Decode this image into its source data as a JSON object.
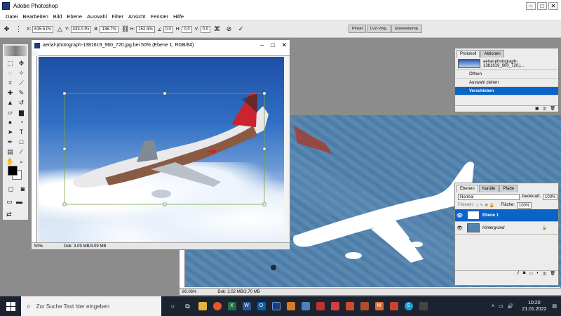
{
  "app": {
    "title": "Adobe Photoshop"
  },
  "window_controls": {
    "minimize": "–",
    "maximize": "□",
    "close": "✕"
  },
  "menu": [
    "Datei",
    "Bearbeiten",
    "Bild",
    "Ebene",
    "Auswahl",
    "Filter",
    "Ansicht",
    "Fenster",
    "Hilfe"
  ],
  "options": {
    "x_label": "X:",
    "x_value": "615.5 Px",
    "y_label": "Y:",
    "y_value": "433.0 Px",
    "b_label": "B:",
    "b_value": "136.7%",
    "h_label": "H:",
    "h_value": "152.4%",
    "angle_value": "0.0",
    "hs_label": "H:",
    "hs_value": "0.0",
    "v_label": "V:",
    "v_value": "0.0",
    "palette_tabs": [
      "Pinsel",
      "LVZ-Vorg.",
      "Ebenenkomp."
    ]
  },
  "doc1": {
    "title": "aerial-photograph-1381619_960_720.jpg bei 50% (Ebene 1, RGB/8#)",
    "zoom": "50%",
    "doc_size": "Dok: 3.09 MB/3.09 MB"
  },
  "doc2": {
    "zoom": "80.06%",
    "doc_size": "Dok: 2.02 MB/2.70 MB"
  },
  "history": {
    "tabs": [
      "Protokoll",
      "Aktionen"
    ],
    "snapshot": "aerial-photograph-1381619_960_720.j...",
    "steps": [
      "Öffnen",
      "Auswahl ziehen",
      "Verschieben"
    ]
  },
  "layers": {
    "tabs": [
      "Ebenen",
      "Kanäle",
      "Pfade"
    ],
    "blend_mode": "Normal",
    "opacity_label": "Deckkraft:",
    "opacity_value": "100%",
    "lock_label": "Fixieren:",
    "fill_label": "Fläche:",
    "fill_value": "100%",
    "items": [
      "Ebene 1",
      "Hintergrund"
    ]
  },
  "taskbar": {
    "search_placeholder": "Zur Suche Text hier eingeben",
    "time": "10:20",
    "date": "21.01.2022"
  },
  "colors": {
    "accent": "#0a63c9",
    "workspace": "#8c8c8c",
    "taskbar": "#1b2330"
  }
}
